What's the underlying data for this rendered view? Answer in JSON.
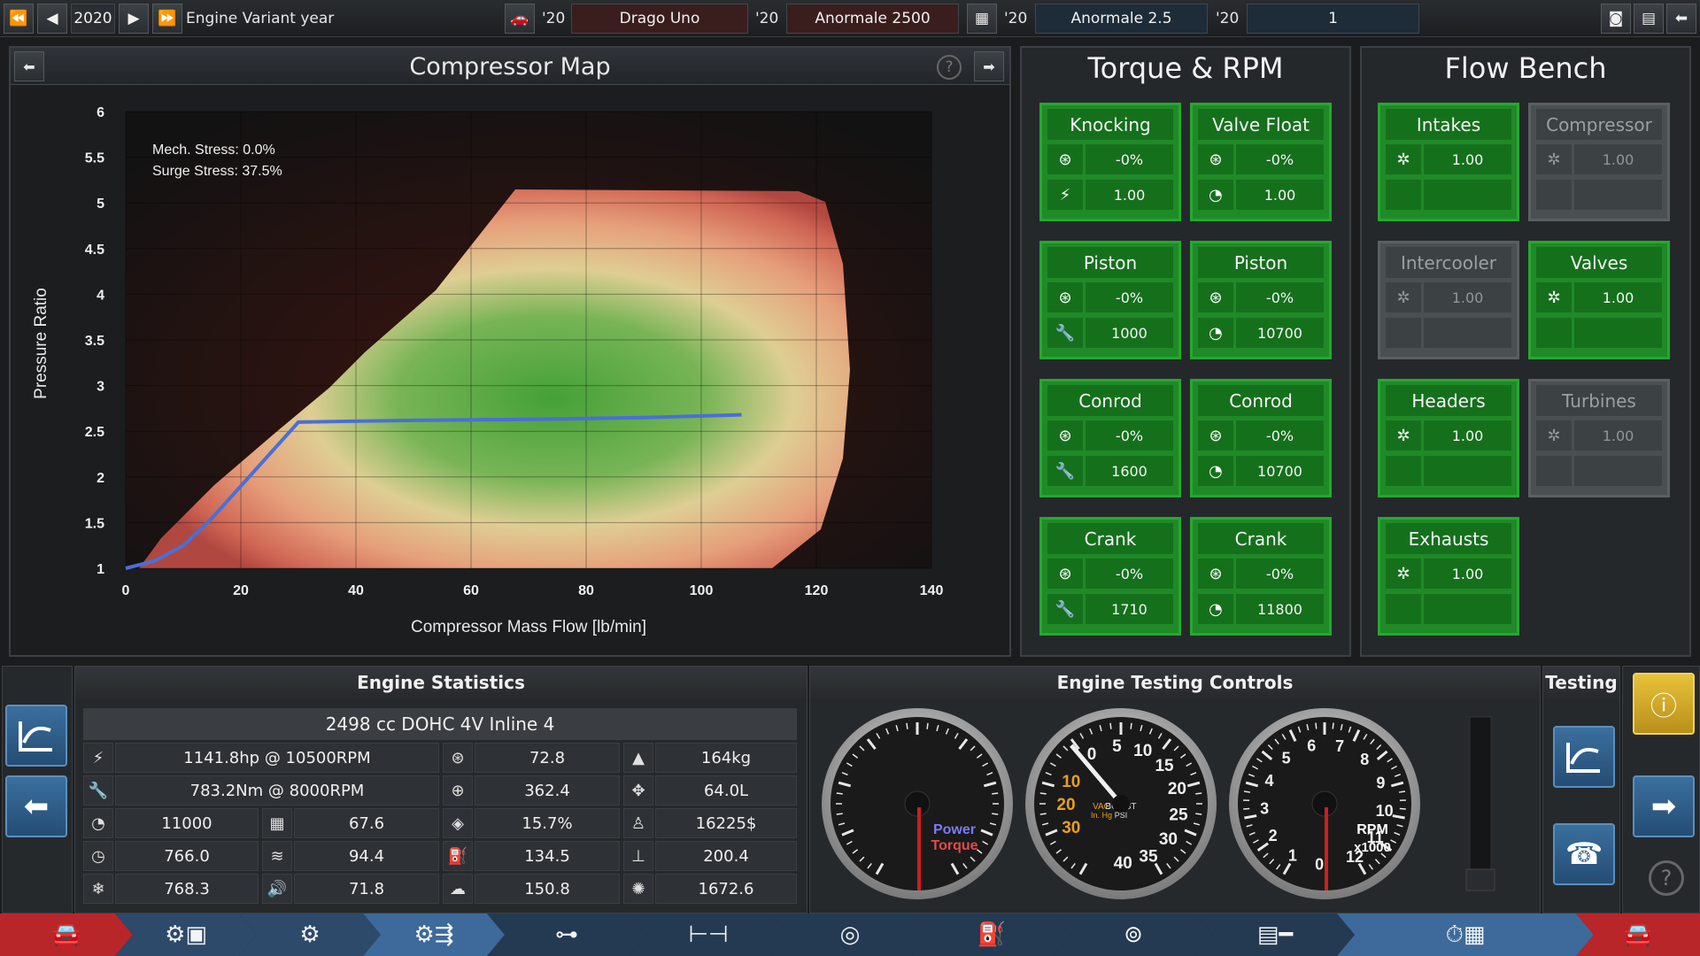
{
  "topbar": {
    "year": "2020",
    "variant_label": "Engine Variant year",
    "slots": [
      {
        "year": "'20",
        "name": "Drago Uno"
      },
      {
        "year": "'20",
        "name": "Anormale 2500"
      },
      {
        "year": "'20",
        "name": "Anormale 2.5"
      },
      {
        "year": "'20",
        "name": "1"
      }
    ]
  },
  "compressor_map": {
    "title": "Compressor Map",
    "mech_stress": "Mech. Stress: 0.0%",
    "surge_stress": "Surge Stress: 37.5%",
    "help": "?"
  },
  "chart_data": {
    "type": "line",
    "xlabel": "Compressor Mass Flow [lb/min]",
    "ylabel": "Pressure Ratio",
    "xlim": [
      0,
      140
    ],
    "ylim": [
      1,
      6
    ],
    "xticks": [
      "0",
      "20",
      "40",
      "60",
      "80",
      "100",
      "120",
      "140"
    ],
    "yticks": [
      "1",
      "1.5",
      "2",
      "2.5",
      "3",
      "3.5",
      "4",
      "4.5",
      "5",
      "5.5",
      "6"
    ],
    "grid": true,
    "series": [
      {
        "color": "#4a6fd6",
        "x": [
          0,
          5,
          10,
          15,
          20,
          25,
          30,
          50,
          70,
          90,
          107
        ],
        "y": [
          1.0,
          1.08,
          1.25,
          1.55,
          1.9,
          2.25,
          2.6,
          2.62,
          2.63,
          2.65,
          2.68
        ]
      }
    ]
  },
  "torque_rpm": {
    "title": "Torque & RPM",
    "cards": [
      {
        "title": "Knocking",
        "r1_icon": "turbo-icon",
        "r1": "-0%",
        "r2_icon": "spark-icon",
        "r2": "1.00"
      },
      {
        "title": "Valve Float",
        "r1_icon": "turbo-icon",
        "r1": "-0%",
        "r2_icon": "gauge-icon",
        "r2": "1.00"
      },
      {
        "title": "Piston",
        "r1_icon": "turbo-icon",
        "r1": "-0%",
        "r2_icon": "wrench-icon",
        "r2": "1000"
      },
      {
        "title": "Piston",
        "r1_icon": "turbo-icon",
        "r1": "-0%",
        "r2_icon": "gauge-icon",
        "r2": "10700"
      },
      {
        "title": "Conrod",
        "r1_icon": "turbo-icon",
        "r1": "-0%",
        "r2_icon": "wrench-icon",
        "r2": "1600"
      },
      {
        "title": "Conrod",
        "r1_icon": "turbo-icon",
        "r1": "-0%",
        "r2_icon": "gauge-icon",
        "r2": "10700"
      },
      {
        "title": "Crank",
        "r1_icon": "turbo-icon",
        "r1": "-0%",
        "r2_icon": "wrench-icon",
        "r2": "1710"
      },
      {
        "title": "Crank",
        "r1_icon": "turbo-icon",
        "r1": "-0%",
        "r2_icon": "gauge-icon",
        "r2": "11800"
      }
    ]
  },
  "flow_bench": {
    "title": "Flow Bench",
    "cards": [
      {
        "title": "Intakes",
        "value": "1.00",
        "enabled": true
      },
      {
        "title": "Compressor",
        "value": "1.00",
        "enabled": false
      },
      {
        "title": "Intercooler",
        "value": "1.00",
        "enabled": false
      },
      {
        "title": "Valves",
        "value": "1.00",
        "enabled": true
      },
      {
        "title": "Headers",
        "value": "1.00",
        "enabled": true
      },
      {
        "title": "Turbines",
        "value": "1.00",
        "enabled": false
      },
      {
        "title": "Exhausts",
        "value": "1.00",
        "enabled": true
      }
    ]
  },
  "engine_stats": {
    "title": "Engine Statistics",
    "summary": "2498 cc DOHC 4V  Inline 4",
    "power": "1141.8hp @ 10500RPM",
    "torque": "783.2Nm @ 8000RPM",
    "rpm_limit": "11000",
    "idle": "766.0",
    "cooling": "768.3",
    "c2_r3": "67.6",
    "c2_r4": "94.4",
    "c2_r5": "71.8",
    "c3_r1": "72.8",
    "c3_r2": "362.4",
    "c3_r3": "15.7%",
    "c3_r4": "134.5",
    "c3_r5": "150.8",
    "weight": "164kg",
    "volume": "64.0L",
    "cost": "16225$",
    "c4_r4": "200.4",
    "c4_r5": "1672.6"
  },
  "testing_controls": {
    "title": "Engine Testing Controls",
    "gauge1": {
      "power_label": "Power",
      "torque_label": "Torque"
    },
    "gauge2": {
      "vac_label": "VAC",
      "vac_unit": "In. Hg",
      "boost_label": "BOOST",
      "boost_unit": "PSI",
      "vac_ticks": [
        "10",
        "20",
        "30"
      ],
      "boost_ticks": [
        "0",
        "5",
        "10",
        "15",
        "20",
        "25",
        "30",
        "35",
        "40"
      ]
    },
    "gauge3": {
      "label": "RPM",
      "unit": "x1000",
      "ticks": [
        "0",
        "1",
        "2",
        "3",
        "4",
        "5",
        "6",
        "7",
        "8",
        "9",
        "10",
        "11",
        "12"
      ]
    }
  },
  "testing": {
    "title": "Testing",
    "help": "?"
  },
  "colors": {
    "accent_green": "#1f8a27",
    "disabled_grey": "#4a4f52",
    "blue_button": "#2d5f8d",
    "alert_yellow": "#e0b323"
  }
}
